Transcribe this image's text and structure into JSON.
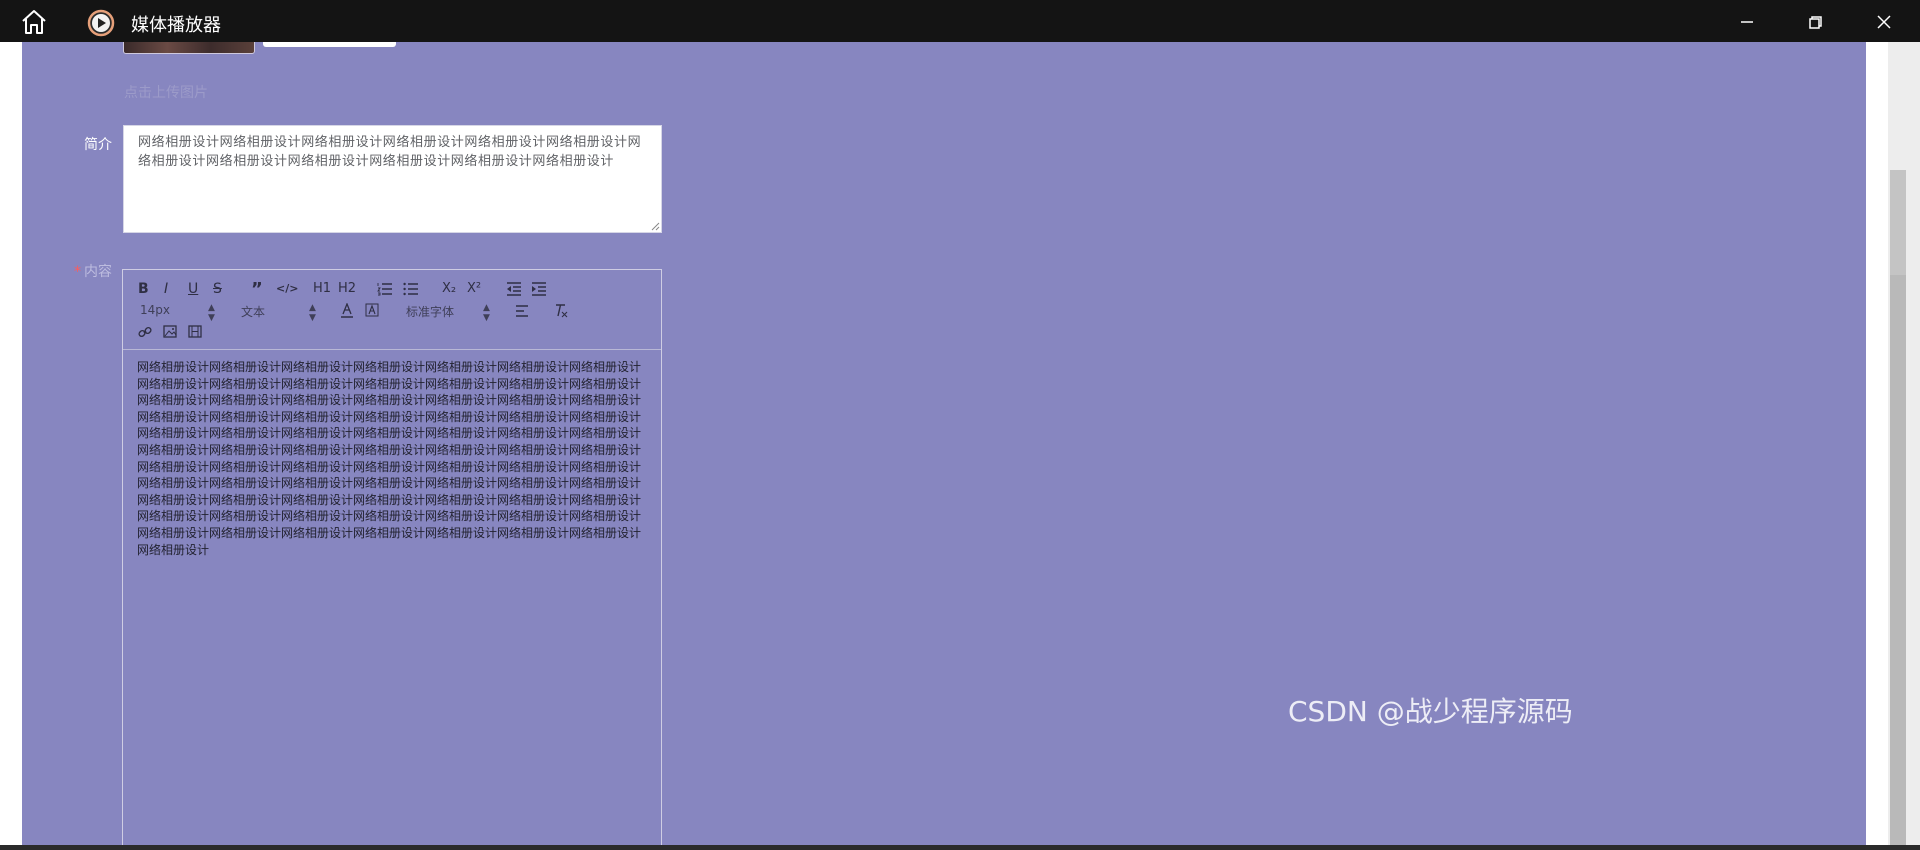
{
  "window": {
    "title": "媒体播放器",
    "home_icon": "home-icon",
    "app_icon": "play-icon",
    "controls": [
      "minimize-icon",
      "maximize-icon",
      "close-icon"
    ]
  },
  "form": {
    "hint": "点击上传图片",
    "intro_label": "简介",
    "intro_text": "网络相册设计网络相册设计网络相册设计网络相册设计网络相册设计网络相册设计网络相册设计网络相册设计网络相册设计网络相册设计网络相册设计网络相册设计",
    "content_label": "内容",
    "required_mark": "*"
  },
  "editor": {
    "toolbar": {
      "bold": "B",
      "italic": "I",
      "underline": "U",
      "strike": "S",
      "blockquote": "”",
      "code": "</>",
      "h1": "H1",
      "h2": "H2",
      "subscript": "X₂",
      "superscript": "X²",
      "font_size": "14px",
      "text_type": "文本",
      "font_family": "标准字体"
    },
    "body": "网络相册设计网络相册设计网络相册设计网络相册设计网络相册设计网络相册设计网络相册设计网络相册设计网络相册设计网络相册设计网络相册设计网络相册设计网络相册设计网络相册设计网络相册设计网络相册设计网络相册设计网络相册设计网络相册设计网络相册设计网络相册设计网络相册设计网络相册设计网络相册设计网络相册设计网络相册设计网络相册设计网络相册设计网络相册设计网络相册设计网络相册设计网络相册设计网络相册设计网络相册设计网络相册设计网络相册设计网络相册设计网络相册设计网络相册设计网络相册设计网络相册设计网络相册设计网络相册设计网络相册设计网络相册设计网络相册设计网络相册设计网络相册设计网络相册设计网络相册设计网络相册设计网络相册设计网络相册设计网络相册设计网络相册设计网络相册设计网络相册设计网络相册设计网络相册设计网络相册设计网络相册设计网络相册设计网络相册设计网络相册设计网络相册设计网络相册设计网络相册设计网络相册设计网络相册设计网络相册设计网络相册设计网络相册设计网络相册设计网络相册设计网络相册设计网络相册设计网络相册设计网络相册设计"
  },
  "watermark": "CSDN @战少程序源码",
  "colors": {
    "page_bg": "#8786c0",
    "titlebar": "#141414"
  }
}
